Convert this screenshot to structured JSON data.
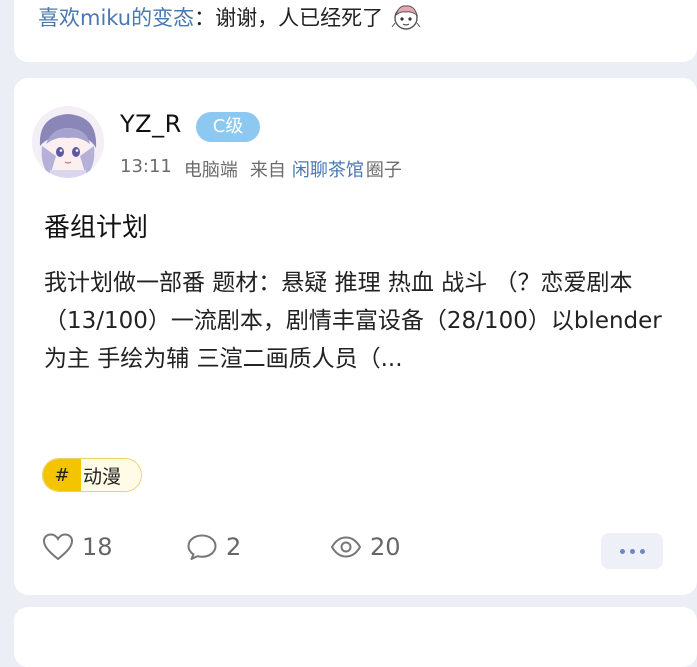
{
  "previous_comment": {
    "author": "喜欢miku的变态",
    "separator": "：",
    "text": "谢谢，人已经死了",
    "sticker_icon": "chibi-sticker-icon"
  },
  "post": {
    "author": {
      "name": "YZ_R",
      "level_badge": "C级",
      "avatar_icon": "anime-girl-avatar-icon"
    },
    "meta": {
      "time": "13:11",
      "device": "电脑端",
      "from_label": "来自",
      "circle_name": "闲聊茶馆",
      "circle_suffix": "圈子"
    },
    "title": "番组计划",
    "body": "我计划做一部番 题材：悬疑 推理 热血 战斗 （？恋爱剧本（13/100）一流剧本，剧情丰富设备（28/100）以blender为主 手绘为辅 三渲二画质人员（...",
    "tag": {
      "hash": "#",
      "label": "动漫"
    },
    "stats": {
      "likes": "18",
      "comments": "2",
      "views": "20"
    }
  },
  "colors": {
    "background": "#eceef5",
    "link": "#4a78b3",
    "level_badge": "#8cc8ef",
    "tag_accent": "#f4c400",
    "more_dots": "#6f86c6"
  }
}
